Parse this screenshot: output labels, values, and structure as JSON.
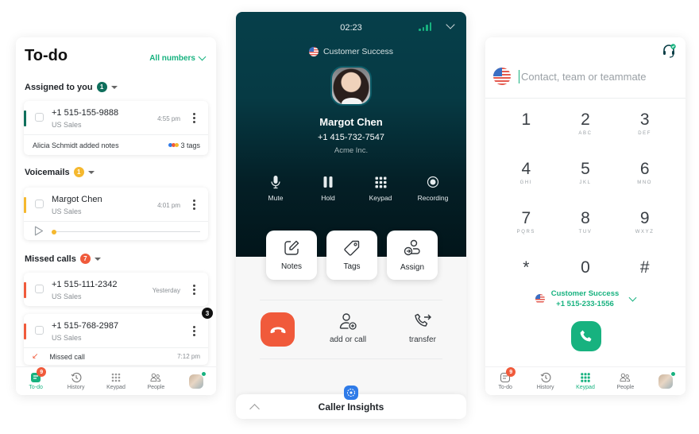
{
  "colors": {
    "brand_green": "#17b27f",
    "call_header": "#063f4a",
    "hangup_red": "#f05a3b",
    "voicemail_yellow": "#f5b82e",
    "assigned_teal": "#0f6f5c",
    "insights_blue": "#2f7be8"
  },
  "todo": {
    "title": "To-do",
    "filter_label": "All numbers",
    "sections": {
      "assigned": {
        "label": "Assigned to you",
        "count": "1",
        "items": [
          {
            "phone": "+1 515-155-9888",
            "line": "US Sales",
            "time": "4:55 pm",
            "note": "Alicia Schmidt added notes",
            "tags": "3 tags"
          }
        ]
      },
      "voicemails": {
        "label": "Voicemails",
        "count": "1",
        "items": [
          {
            "name": "Margot Chen",
            "line": "US Sales",
            "time": "4:01 pm",
            "playback_progress": 0
          }
        ]
      },
      "missed": {
        "label": "Missed calls",
        "count": "7",
        "items": [
          {
            "phone": "+1 515-111-2342",
            "line": "US Sales",
            "time": "Yesterday"
          },
          {
            "phone": "+1 515-768-2987",
            "line": "US Sales",
            "badge": "3",
            "detail": "Missed call",
            "detail_time": "7:12 pm"
          }
        ]
      }
    },
    "nav": {
      "items": [
        {
          "label": "To-do",
          "icon": "todo-icon",
          "badge": "9",
          "active": true
        },
        {
          "label": "History",
          "icon": "history-icon"
        },
        {
          "label": "Keypad",
          "icon": "keypad-icon"
        },
        {
          "label": "People",
          "icon": "people-icon"
        },
        {
          "label": "",
          "icon": "avatar"
        }
      ]
    }
  },
  "call": {
    "timer": "02:23",
    "line_name": "Customer Success",
    "caller_name": "Margot Chen",
    "caller_phone": "+1 415-732-7547",
    "caller_company": "Acme Inc.",
    "controls": [
      {
        "label": "Mute",
        "icon": "microphone-icon"
      },
      {
        "label": "Hold",
        "icon": "pause-icon"
      },
      {
        "label": "Keypad",
        "icon": "keypad-icon"
      },
      {
        "label": "Recording",
        "icon": "record-icon"
      }
    ],
    "actions": [
      {
        "label": "Notes",
        "icon": "edit-note-icon"
      },
      {
        "label": "Tags",
        "icon": "tag-icon"
      },
      {
        "label": "Assign",
        "icon": "assign-user-icon"
      }
    ],
    "add_or_call": "add or call",
    "transfer": "transfer",
    "insights_label": "Caller Insights"
  },
  "keypad": {
    "search_placeholder": "Contact, team or teammate",
    "search_value": "",
    "keys": [
      {
        "digit": "1",
        "letters": ""
      },
      {
        "digit": "2",
        "letters": "ABC"
      },
      {
        "digit": "3",
        "letters": "DEF"
      },
      {
        "digit": "4",
        "letters": "GHI"
      },
      {
        "digit": "5",
        "letters": "JKL"
      },
      {
        "digit": "6",
        "letters": "MNO"
      },
      {
        "digit": "7",
        "letters": "PQRS"
      },
      {
        "digit": "8",
        "letters": "TUV"
      },
      {
        "digit": "9",
        "letters": "WXYZ"
      },
      {
        "digit": "*",
        "letters": ""
      },
      {
        "digit": "0",
        "letters": ""
      },
      {
        "digit": "#",
        "letters": ""
      }
    ],
    "from_line": "Customer Success",
    "from_number": "+1 515-233-1556",
    "nav": {
      "items": [
        {
          "label": "To-do",
          "icon": "todo-icon",
          "badge": "9"
        },
        {
          "label": "History",
          "icon": "history-icon"
        },
        {
          "label": "Keypad",
          "icon": "keypad-icon",
          "active": true
        },
        {
          "label": "People",
          "icon": "people-icon"
        },
        {
          "label": "",
          "icon": "avatar"
        }
      ]
    }
  }
}
